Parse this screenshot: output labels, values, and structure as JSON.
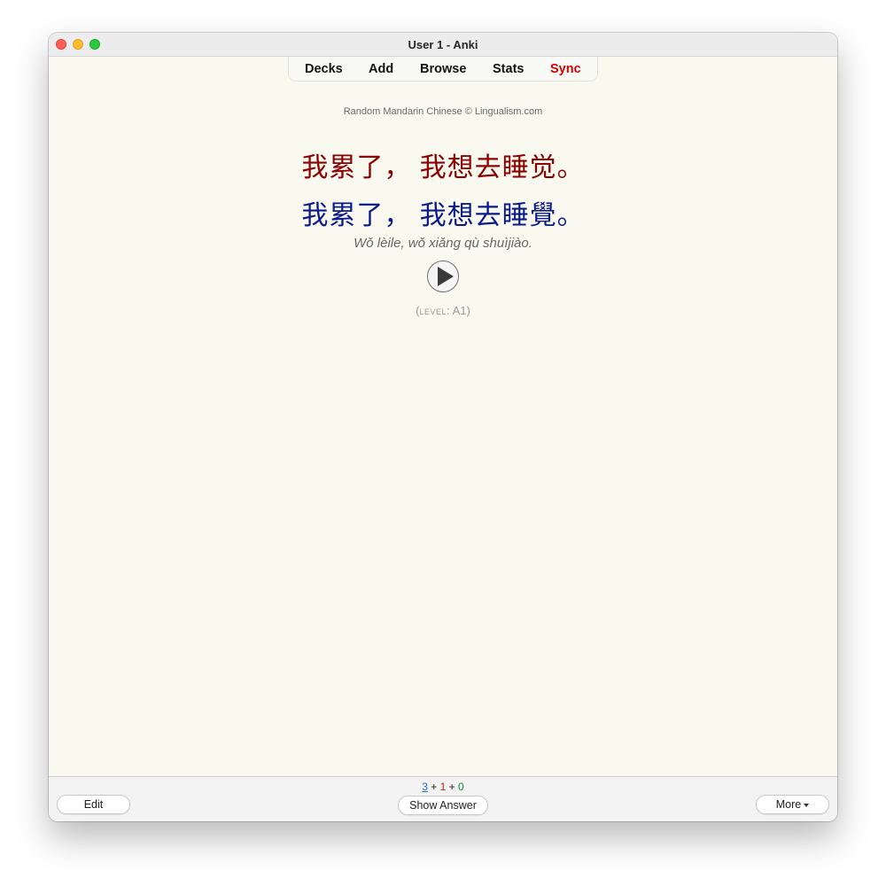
{
  "window": {
    "title": "User 1 - Anki"
  },
  "toolbar": {
    "decks": "Decks",
    "add": "Add",
    "browse": "Browse",
    "stats": "Stats",
    "sync": "Sync",
    "sync_color": "#d40000"
  },
  "card": {
    "attribution": "Random Mandarin Chinese © Lingualism.com",
    "simplified": "我累了， 我想去睡觉。",
    "traditional": "我累了， 我想去睡覺。",
    "pinyin": "Wǒ lèile, wǒ xiǎng qù shuìjiào.",
    "play_icon": "play-icon",
    "level_open": "(",
    "level_label": "level",
    "level_sep": ": ",
    "level_value": "A1",
    "level_close": ")",
    "simplified_color": "#8b0000",
    "traditional_color": "#0b1a8a"
  },
  "bottombar": {
    "edit_label": "Edit",
    "show_answer_label": "Show Answer",
    "more_label": "More",
    "counts": {
      "new": "3",
      "plus1": " + ",
      "learning": "1",
      "plus2": " + ",
      "review": "0"
    }
  }
}
